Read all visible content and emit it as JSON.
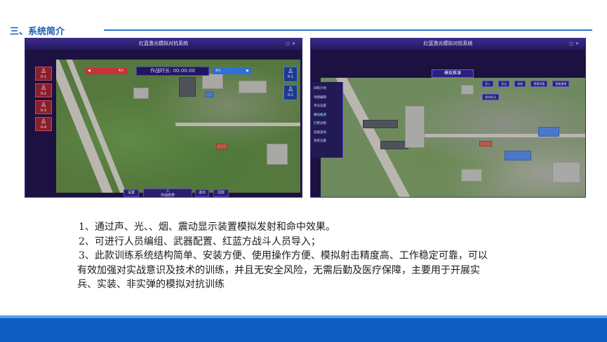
{
  "section": {
    "title": "三、系统简介"
  },
  "screenshots": {
    "left": {
      "window_title": "红蓝激光模拟对抗系统",
      "red_team_value": "4人",
      "blue_team_value": "4人",
      "timer_label": "作战时长: 00:00:00",
      "red_cards": [
        "0-1",
        "0-2",
        "0-3",
        "0-4"
      ],
      "blue_cards": [
        "0-1",
        "0-2"
      ],
      "controls": {
        "settings": "设置",
        "center": "作战态势",
        "center_top": "人",
        "center_right": "退出",
        "replay": "回放"
      }
    },
    "right": {
      "window_title": "红蓝激光模拟对抗系统",
      "panel_header": "模拟推演",
      "menu_items": [
        "训练计划",
        "地图编辑",
        "单兵设置",
        "模拟推演",
        "打靶训练",
        "成绩查询",
        "系统设置"
      ],
      "active_menu_index": 3,
      "toolbar": [
        "导入",
        "导出",
        "标绘",
        "视角切换",
        "智能推演",
        "保存标注"
      ]
    }
  },
  "bullets": [
    "1、通过声、光、、烟、震动显示装置模拟发射和命中效果。",
    "2、可进行人员编组、武器配置、红蓝方战斗人员导入；",
    "3、此款训练系统结构简单、安装方便、使用操作方便、模拟射击精度高、工作稳定可靠，可以",
    "有效加强对实战意识及技术的训练，并且无安全风险，无需后勤及医疗保障，主要用于开展实",
    "兵、实装、非实弹的模拟对抗训练"
  ],
  "colors": {
    "accent": "#1a5fb4",
    "footer": "#0f5ec4",
    "red_team": "#c9303a",
    "blue_team": "#2f6fd8"
  }
}
